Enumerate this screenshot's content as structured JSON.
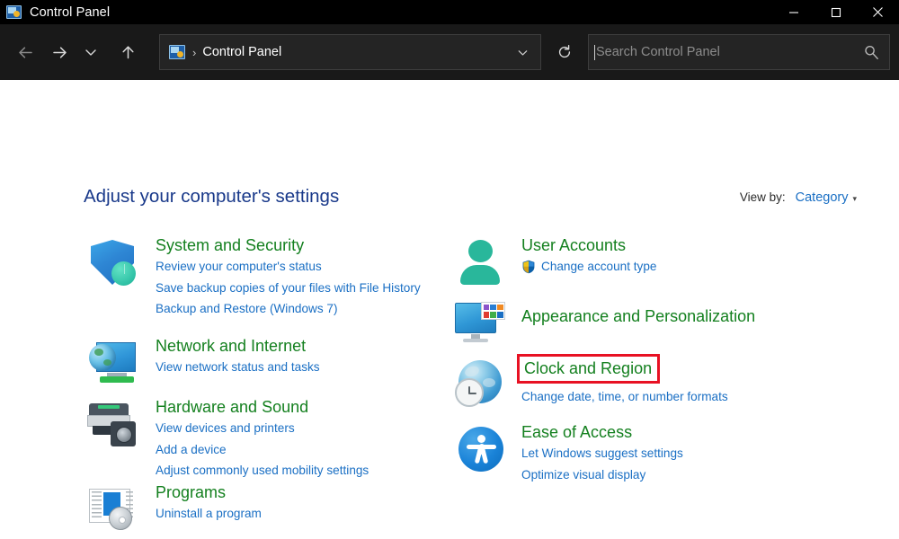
{
  "window": {
    "title": "Control Panel",
    "icon": "control-panel-icon",
    "controls": {
      "minimize": "Minimize",
      "maximize": "Maximize",
      "close": "Close"
    }
  },
  "toolbar": {
    "back": "Back",
    "forward": "Forward",
    "recent": "Recent locations",
    "up": "Up",
    "address": {
      "icon": "control-panel-icon",
      "separator": "›",
      "text": "Control Panel"
    },
    "refresh": "Refresh",
    "search": {
      "placeholder": "Search Control Panel",
      "value": "",
      "icon": "search-icon"
    }
  },
  "content": {
    "page_title": "Adjust your computer's settings",
    "view_by": {
      "label": "View by:",
      "value": "Category",
      "arrow": "▾"
    }
  },
  "colors": {
    "titlebar_bg": "#000000",
    "toolbar_bg": "#191919",
    "page_title": "#19398a",
    "category_title": "#14801f",
    "link": "#1a6fc4",
    "highlight_box": "#e81123",
    "content_bg": "#ffffff"
  },
  "categories": {
    "left": [
      {
        "title": "System and Security",
        "icon": "shield-icon",
        "highlighted": false,
        "links": [
          "Review your computer's status",
          "Save backup copies of your files with File History",
          "Backup and Restore (Windows 7)"
        ]
      },
      {
        "title": "Network and Internet",
        "icon": "network-monitor-globe-icon",
        "highlighted": false,
        "links": [
          "View network status and tasks"
        ]
      },
      {
        "title": "Hardware and Sound",
        "icon": "printer-speaker-icon",
        "highlighted": false,
        "links": [
          "View devices and printers",
          "Add a device",
          "Adjust commonly used mobility settings"
        ]
      },
      {
        "title": "Programs",
        "icon": "programs-disc-icon",
        "highlighted": false,
        "links": [
          "Uninstall a program"
        ]
      }
    ],
    "right": [
      {
        "title": "User Accounts",
        "icon": "user-person-icon",
        "highlighted": false,
        "links": [
          "Change account type"
        ],
        "shield_link_index": 0
      },
      {
        "title": "Appearance and Personalization",
        "icon": "appearance-monitor-icon",
        "highlighted": false,
        "links": []
      },
      {
        "title": "Clock and Region",
        "icon": "clock-globe-icon",
        "highlighted": true,
        "links": [
          "Change date, time, or number formats"
        ]
      },
      {
        "title": "Ease of Access",
        "icon": "ease-of-access-icon",
        "highlighted": false,
        "links": [
          "Let Windows suggest settings",
          "Optimize visual display"
        ]
      }
    ]
  }
}
